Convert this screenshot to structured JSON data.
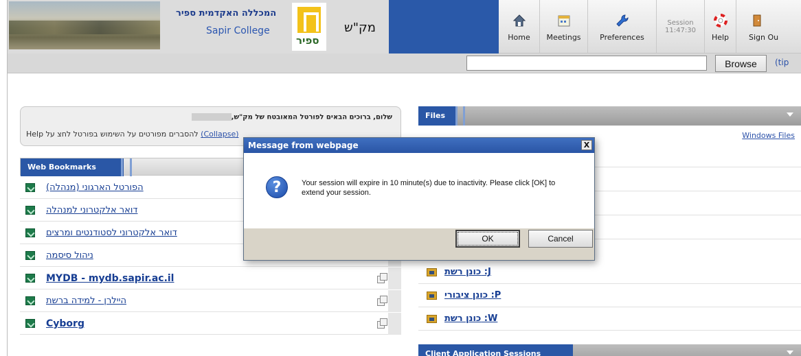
{
  "header": {
    "college_hebrew": "המכללה האקדמית ספיר",
    "college_english": "Sapir College",
    "logo_text": "ספיר",
    "portal_name": "מק\"ש"
  },
  "toolbar": {
    "home": "Home",
    "meetings": "Meetings",
    "preferences": "Preferences",
    "session_label": "Session",
    "session_time": "11:47:30",
    "help": "Help",
    "sign_out": "Sign Ou"
  },
  "upload": {
    "value": "",
    "browse_label": "Browse",
    "tips_link": "(tip"
  },
  "welcome": {
    "greeting": "שלום, ברוכים הבאים לפורטל המאובטח של מק\"ש,",
    "help_text": "Help להסברים מפורטים על השימוש בפורטל לחצ על",
    "collapse": "(Collapse)"
  },
  "bookmarks": {
    "title": "Web Bookmarks",
    "items": [
      {
        "label": "הפורטל הארגוני (מנהלה)"
      },
      {
        "label": "דואר אלקטרוני למנהלה"
      },
      {
        "label": "דואר אלקטרוני לסטודנטים ומרצים"
      },
      {
        "label": "ניהול סיסמה"
      },
      {
        "label": "MYDB - mydb.sapir.ac.il"
      },
      {
        "label": "היילרן - למידה ברשת"
      },
      {
        "label": "Cyborg"
      }
    ]
  },
  "files": {
    "title": "Files",
    "windows_files": "Windows Files",
    "items": [
      {
        "label": "כונן רשת :J"
      },
      {
        "label": "כונן ציבורי :P"
      },
      {
        "label": "כונן רשת :W"
      }
    ]
  },
  "client_sessions": {
    "title": "Client Application Sessions"
  },
  "dialog": {
    "title": "Message from webpage",
    "close": "X",
    "message": "Your session will expire in 10 minute(s) due to inactivity. Please click [OK] to extend your session.",
    "ok_label": "OK",
    "cancel_label": "Cancel"
  }
}
